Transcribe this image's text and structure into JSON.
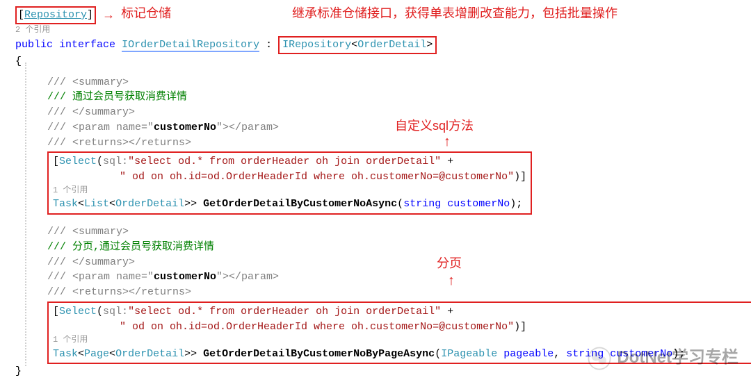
{
  "annotations": {
    "top_right": "继承标准仓储接口，获得单表增删改查能力，包括批量操作",
    "mark_repo": "标记仓储",
    "custom_sql": "自定义sql方法",
    "paging": "分页"
  },
  "code": {
    "repo_attr_open": "[",
    "repo_attr_name": "Repository",
    "repo_attr_close": "]",
    "refs2": "2 个引用",
    "decl_public": "public",
    "decl_interface": "interface",
    "iface_name": "IOrderDetailRepository",
    "colon": " : ",
    "base_iface": "IRepository",
    "base_generic": "OrderDetail",
    "brace_open": "{",
    "brace_close": "}",
    "doc_summary_open": "/// <summary>",
    "doc_summary_close": "/// </summary>",
    "doc_text1": "/// 通过会员号获取消费详情",
    "doc_text2": "/// 分页,通过会员号获取消费详情",
    "doc_param": "/// <param name=\"",
    "doc_param_name": "customerNo",
    "doc_param_end": "\"></param>",
    "doc_returns": "/// <returns></returns>",
    "select_attr_open": "[",
    "select_attr_name": "Select",
    "select_lparen": "(",
    "select_paramlabel": "sql:",
    "select_sql_l1": "\"select od.* from orderHeader oh join orderDetail\"",
    "select_plus": " +",
    "select_sql_l2": "\" od on oh.id=od.OrderHeaderId where oh.customerNo=@customerNo\"",
    "select_rparen_close": ")]",
    "refs1": "1 个引用",
    "task": "Task",
    "list": "List",
    "page": "Page",
    "order_detail": "OrderDetail",
    "gt2": ">>",
    "method1": "GetOrderDetailByCustomerNoAsync",
    "method2": "GetOrderDetailByCustomerNoByPageAsync",
    "paren_open": "(",
    "paren_close_semi": ");",
    "string_kw": "string",
    "param1_name": "customerNo",
    "ipageable": "IPageable",
    "param_pageable": "pageable",
    "comma": ", ",
    "string_kw2": "string",
    "param2_name": "customerNo",
    "watermark": "DotNet学习专栏"
  }
}
